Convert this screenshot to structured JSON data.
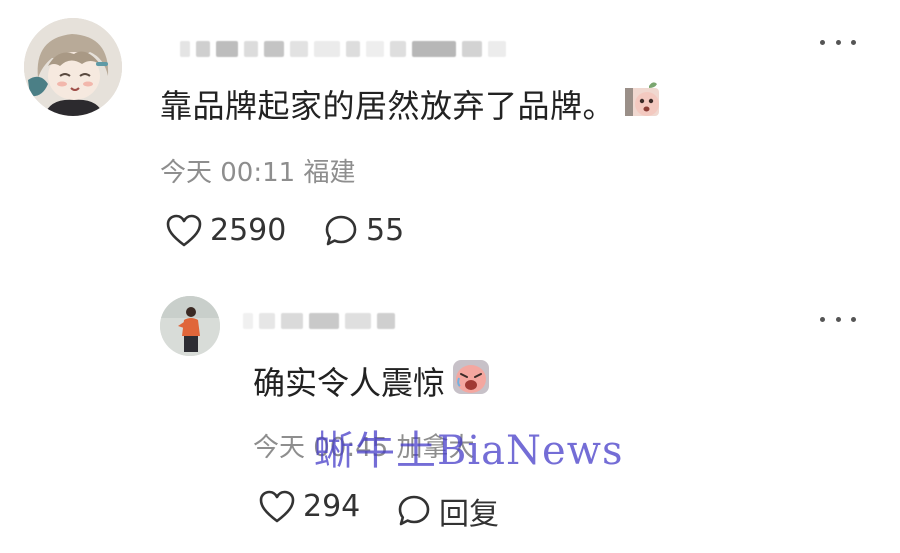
{
  "comment": {
    "text": "靠品牌起家的居然放弃了品牌。",
    "time": "今天 00:11",
    "location": "福建",
    "likes": "2590",
    "replies": "55"
  },
  "reply": {
    "text": "确实令人震惊",
    "time": "今天 00:45",
    "location": "加拿大",
    "likes": "294",
    "reply_label": "回复"
  },
  "watermark": "蜥牛土BiaNews",
  "colors": {
    "meta_text": "#8e8e8e",
    "body_text": "#222222",
    "watermark": "#4a3cc8"
  },
  "icons": {
    "more": "more-dots-icon",
    "like": "heart-outline-icon",
    "comment": "speech-bubble-icon"
  }
}
